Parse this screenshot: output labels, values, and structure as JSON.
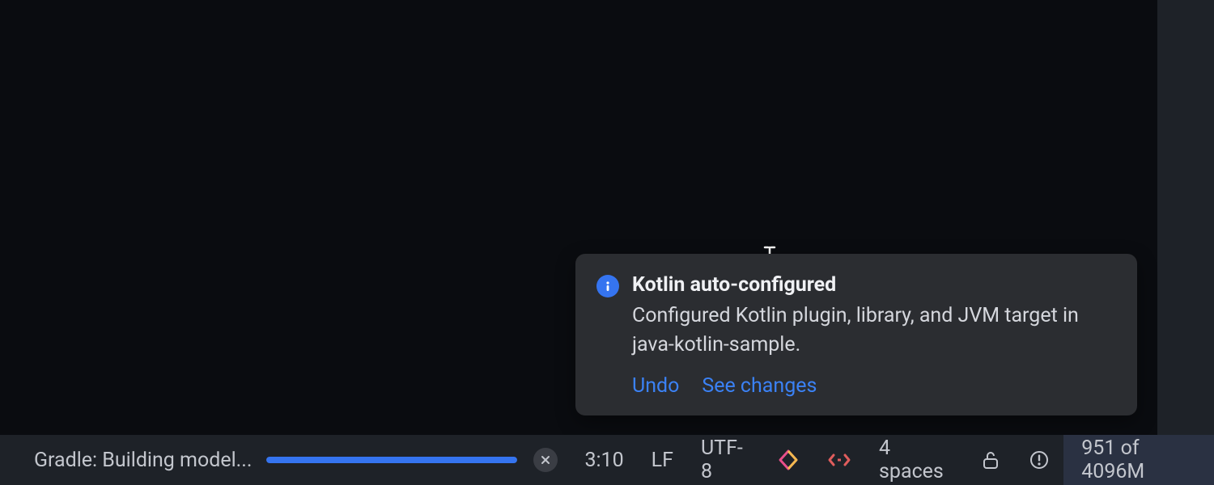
{
  "notification": {
    "title": "Kotlin auto-configured",
    "message": "Configured Kotlin plugin, library, and JVM target in java-kotlin-sample.",
    "actions": {
      "undo": "Undo",
      "see_changes": "See changes"
    }
  },
  "status_bar": {
    "task_label": "Gradle: Building model...",
    "progress_percent": 100,
    "cursor_position": "3:10",
    "line_separator": "LF",
    "encoding": "UTF-8",
    "indent": "4 spaces",
    "memory": "951 of 4096M"
  },
  "colors": {
    "accent": "#3574f0",
    "link": "#3b82f6",
    "panel": "#2b2d31",
    "statusbar": "#1e2228"
  }
}
